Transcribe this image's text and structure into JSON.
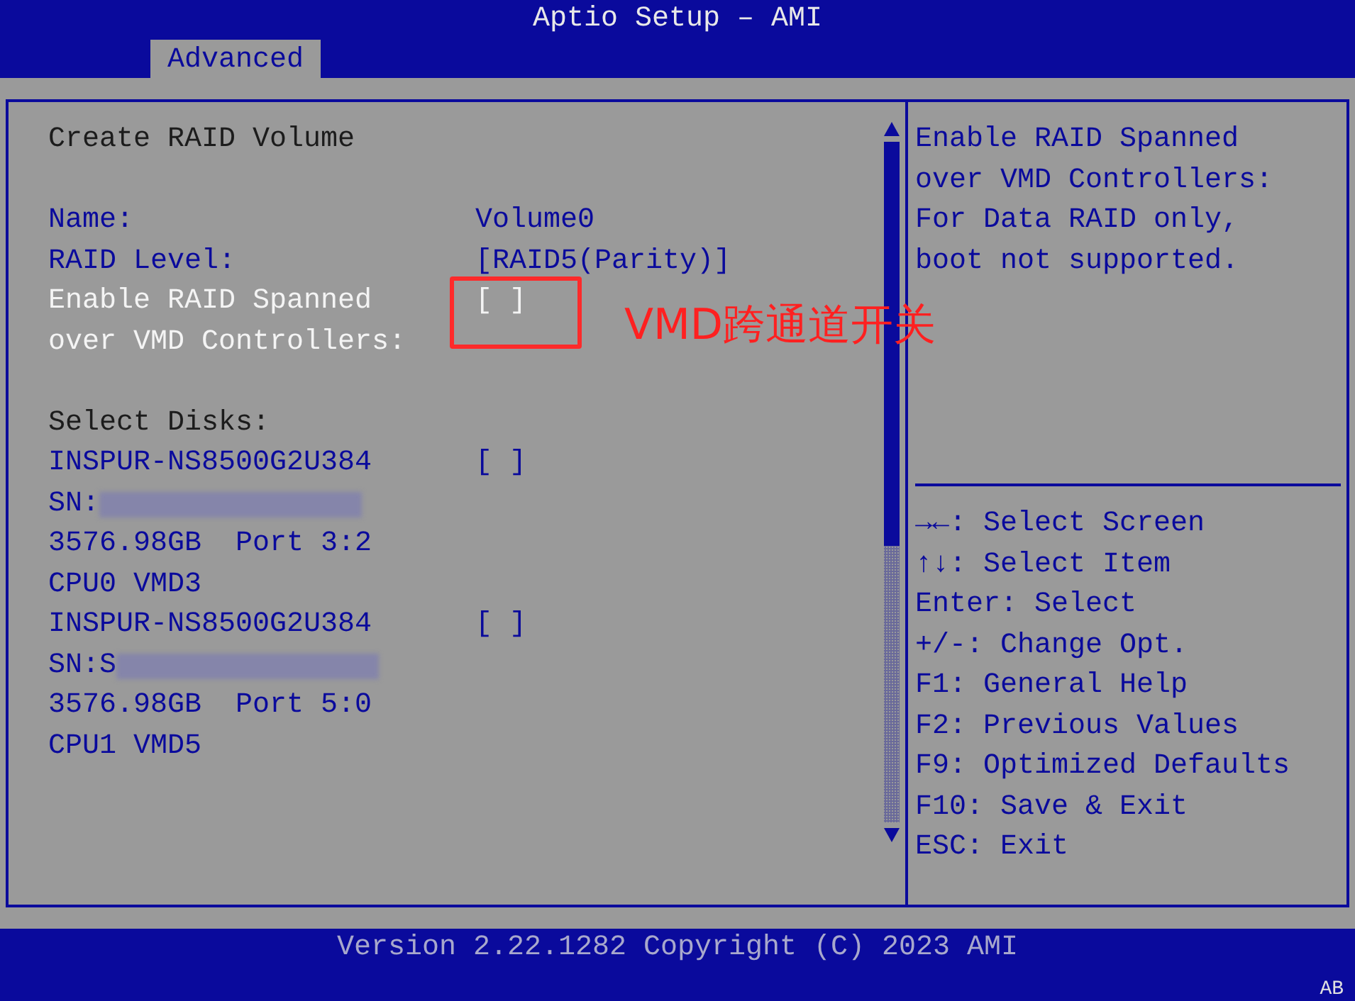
{
  "window": {
    "title": "Aptio Setup – AMI"
  },
  "tabs": [
    {
      "label": "Advanced",
      "selected": true
    }
  ],
  "form": {
    "heading": "Create RAID Volume",
    "options": [
      {
        "label": "Name:",
        "value": "Volume0",
        "selected": false
      },
      {
        "label": "RAID Level:",
        "value": "[RAID5(Parity)]",
        "selected": false
      },
      {
        "label": "Enable RAID Spanned over VMD Controllers:",
        "value": "[ ]",
        "checked": false,
        "selected": true
      }
    ],
    "disks_heading": "Select Disks:",
    "disks": [
      {
        "model": "INSPUR-NS8500G2U384",
        "value": "[ ]",
        "checked": false,
        "sn_label": "SN:",
        "capacity": "3576.98GB  Port 3:2",
        "location": "CPU0 VMD3"
      },
      {
        "model": "INSPUR-NS8500G2U384",
        "value": "[ ]",
        "checked": false,
        "sn_label": "SN:S",
        "capacity": "3576.98GB  Port 5:0",
        "location": "CPU1 VMD5"
      }
    ]
  },
  "annotation": {
    "text": "VMD跨通道开关"
  },
  "help": {
    "text": "Enable RAID Spanned over VMD Controllers: For Data RAID only, boot not supported.",
    "keys": [
      "→←: Select Screen",
      "↑↓: Select Item",
      "Enter: Select",
      "+/-: Change Opt.",
      "F1: General Help",
      "F2: Previous Values",
      "F9: Optimized Defaults",
      "F10: Save & Exit",
      "ESC: Exit"
    ]
  },
  "status_bar": {
    "version": "Version 2.22.1282 Copyright (C) 2023 AMI",
    "code": "AB"
  }
}
